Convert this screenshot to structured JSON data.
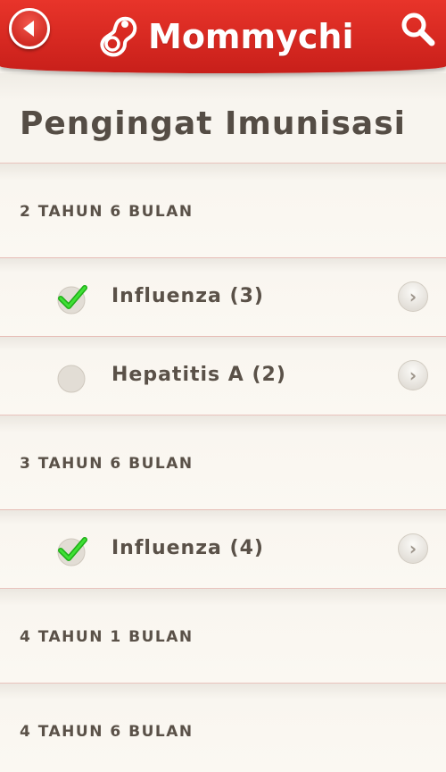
{
  "header": {
    "app_name": "Mommychi",
    "back_icon": "back-arrow-icon",
    "search_icon": "search-icon",
    "brand_color": "#d9261f"
  },
  "page": {
    "title": "Pengingat Imunisasi"
  },
  "groups": [
    {
      "label": "2 TAHUN 6 BULAN",
      "items": [
        {
          "label": "Influenza (3)",
          "checked": true
        },
        {
          "label": "Hepatitis A (2)",
          "checked": false
        }
      ]
    },
    {
      "label": "3 TAHUN 6 BULAN",
      "items": [
        {
          "label": "Influenza (4)",
          "checked": true
        }
      ]
    },
    {
      "label": "4 TAHUN 1 BULAN",
      "items": []
    },
    {
      "label": "4 TAHUN 6 BULAN",
      "items": []
    }
  ],
  "colors": {
    "check_green": "#28c420",
    "text": "#5a5148"
  }
}
